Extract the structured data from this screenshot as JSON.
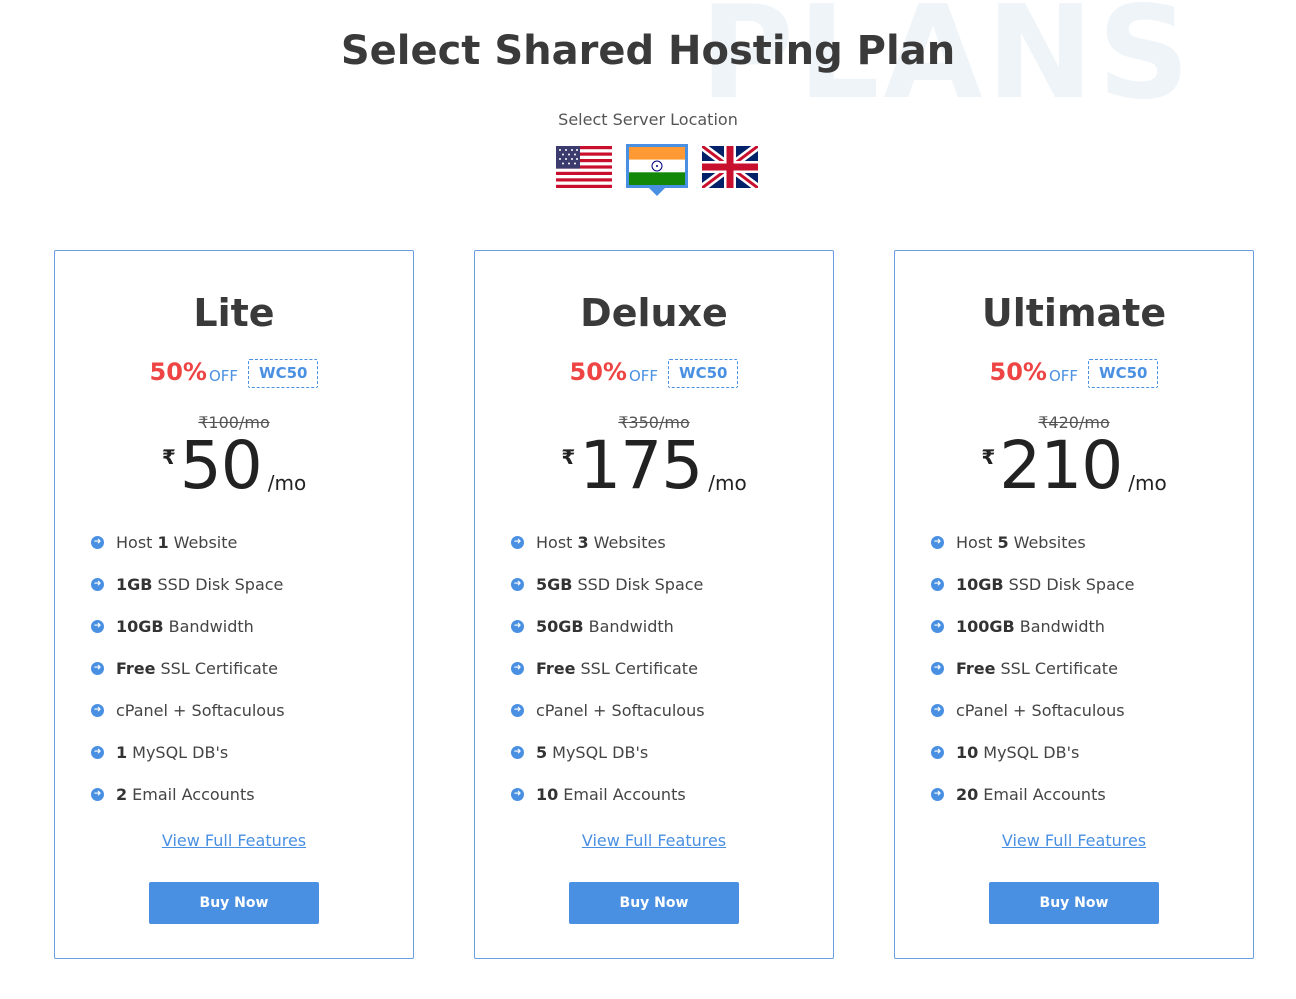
{
  "background_word": "PLANS",
  "title": "Select Shared Hosting Plan",
  "location_label": "Select Server Location",
  "locations": [
    {
      "name": "USA",
      "selected": false
    },
    {
      "name": "India",
      "selected": true
    },
    {
      "name": "UK",
      "selected": false
    }
  ],
  "accent_color": "#4a90e2",
  "discount_color": "#ef4444",
  "plans": [
    {
      "name": "Lite",
      "discount_pct": "50%",
      "off_label": "OFF",
      "coupon": "WC50",
      "old_price": "₹100/mo",
      "currency": "₹",
      "price": "50",
      "per": "/mo",
      "features": [
        {
          "prefix": "Host",
          "bold": "1",
          "rest": "Website"
        },
        {
          "prefix": "",
          "bold": "1GB",
          "rest": "SSD Disk Space"
        },
        {
          "prefix": "",
          "bold": "10GB",
          "rest": "Bandwidth"
        },
        {
          "prefix": "",
          "bold": "Free",
          "rest": "SSL Certificate"
        },
        {
          "prefix": "",
          "bold": "",
          "rest": "cPanel + Softaculous"
        },
        {
          "prefix": "",
          "bold": "1",
          "rest": "MySQL DB's"
        },
        {
          "prefix": "",
          "bold": "2",
          "rest": "Email Accounts"
        }
      ],
      "view_link": "View Full Features",
      "buy_label": "Buy Now"
    },
    {
      "name": "Deluxe",
      "discount_pct": "50%",
      "off_label": "OFF",
      "coupon": "WC50",
      "old_price": "₹350/mo",
      "currency": "₹",
      "price": "175",
      "per": "/mo",
      "features": [
        {
          "prefix": "Host",
          "bold": "3",
          "rest": "Websites"
        },
        {
          "prefix": "",
          "bold": "5GB",
          "rest": "SSD Disk Space"
        },
        {
          "prefix": "",
          "bold": "50GB",
          "rest": "Bandwidth"
        },
        {
          "prefix": "",
          "bold": "Free",
          "rest": "SSL Certificate"
        },
        {
          "prefix": "",
          "bold": "",
          "rest": "cPanel + Softaculous"
        },
        {
          "prefix": "",
          "bold": "5",
          "rest": "MySQL DB's"
        },
        {
          "prefix": "",
          "bold": "10",
          "rest": "Email Accounts"
        }
      ],
      "view_link": "View Full Features",
      "buy_label": "Buy Now"
    },
    {
      "name": "Ultimate",
      "discount_pct": "50%",
      "off_label": "OFF",
      "coupon": "WC50",
      "old_price": "₹420/mo",
      "currency": "₹",
      "price": "210",
      "per": "/mo",
      "features": [
        {
          "prefix": "Host",
          "bold": "5",
          "rest": "Websites"
        },
        {
          "prefix": "",
          "bold": "10GB",
          "rest": "SSD Disk Space"
        },
        {
          "prefix": "",
          "bold": "100GB",
          "rest": "Bandwidth"
        },
        {
          "prefix": "",
          "bold": "Free",
          "rest": "SSL Certificate"
        },
        {
          "prefix": "",
          "bold": "",
          "rest": "cPanel + Softaculous"
        },
        {
          "prefix": "",
          "bold": "10",
          "rest": "MySQL DB's"
        },
        {
          "prefix": "",
          "bold": "20",
          "rest": "Email Accounts"
        }
      ],
      "view_link": "View Full Features",
      "buy_label": "Buy Now"
    }
  ]
}
